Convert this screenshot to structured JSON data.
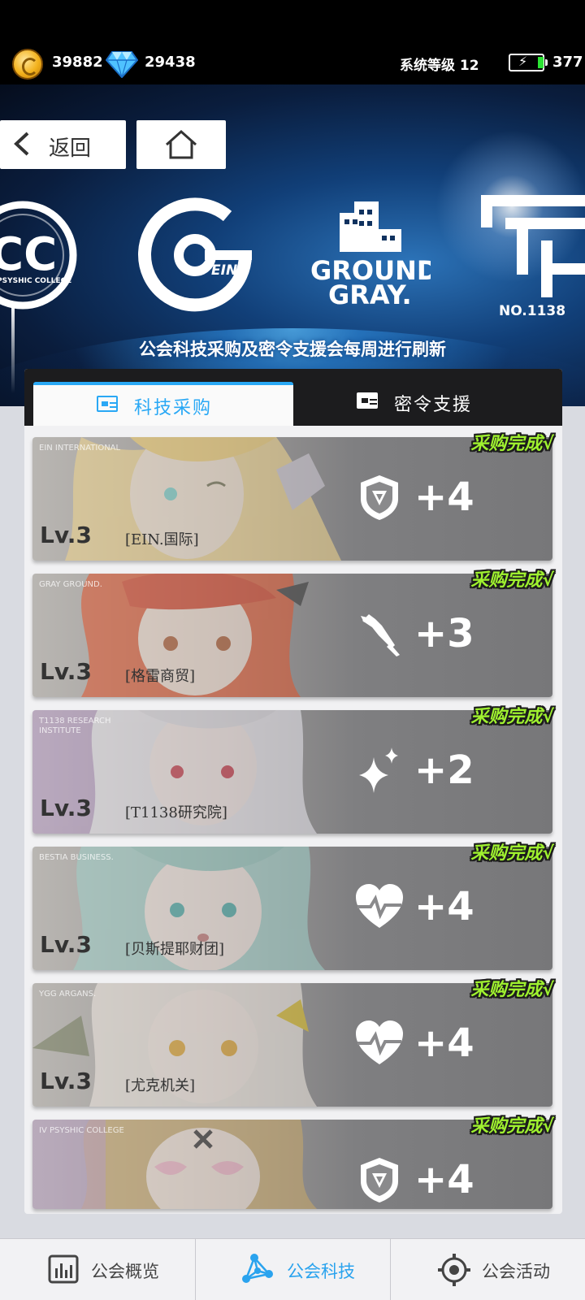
{
  "status": {
    "coins": "39882",
    "gems": "29438",
    "system_level": "系统等级 12",
    "energy": "377"
  },
  "nav": {
    "back_label": "返回"
  },
  "hero": {
    "logos": {
      "ivpc_text": "PSYSHIC COLLEGE",
      "ein_text": "EIN",
      "groundgray_line1": "GROUND",
      "groundgray_line2": "GRAY.",
      "t1138_text": "NO.1138"
    },
    "caption": "公会科技采购及密令支援会每周进行刷新"
  },
  "tabs": [
    {
      "label": "科技采购",
      "active": true
    },
    {
      "label": "密令支援",
      "active": false
    }
  ],
  "cards": [
    {
      "tagline": "EIN INTERNATIONAL",
      "level": "Lv.3",
      "name": "[EIN.国际]",
      "icon": "shield-icon",
      "bonus": "+4",
      "status": "采购完成√"
    },
    {
      "tagline": "GRAY GROUND.",
      "level": "Lv.3",
      "name": "[格雷商贸]",
      "icon": "blade-icon",
      "bonus": "+3",
      "status": "采购完成√"
    },
    {
      "tagline": "T1138 RESEARCH INSTITUTE",
      "level": "Lv.3",
      "name": "[T1138研究院]",
      "icon": "sparkle-icon",
      "bonus": "+2",
      "status": "采购完成√"
    },
    {
      "tagline": "BESTIA BUSINESS.",
      "level": "Lv.3",
      "name": "[贝斯提耶财团]",
      "icon": "heartbeat-icon",
      "bonus": "+4",
      "status": "采购完成√"
    },
    {
      "tagline": "YGG ARGANS.",
      "level": "Lv.3",
      "name": "[尤克机关]",
      "icon": "heartbeat-icon",
      "bonus": "+4",
      "status": "采购完成√"
    },
    {
      "tagline": "IV PSYSHIC COLLEGE",
      "level": "",
      "name": "",
      "icon": "shield-icon",
      "bonus": "+4",
      "status": "采购完成√"
    }
  ],
  "bottom_nav": [
    {
      "label": "公会概览",
      "icon": "chart-icon"
    },
    {
      "label": "公会科技",
      "icon": "network-icon",
      "active": true
    },
    {
      "label": "公会活动",
      "icon": "target-icon"
    }
  ],
  "colors": {
    "accent": "#29a8f5",
    "complete": "#9ff12f",
    "card_bg": "#8a8a8c"
  }
}
